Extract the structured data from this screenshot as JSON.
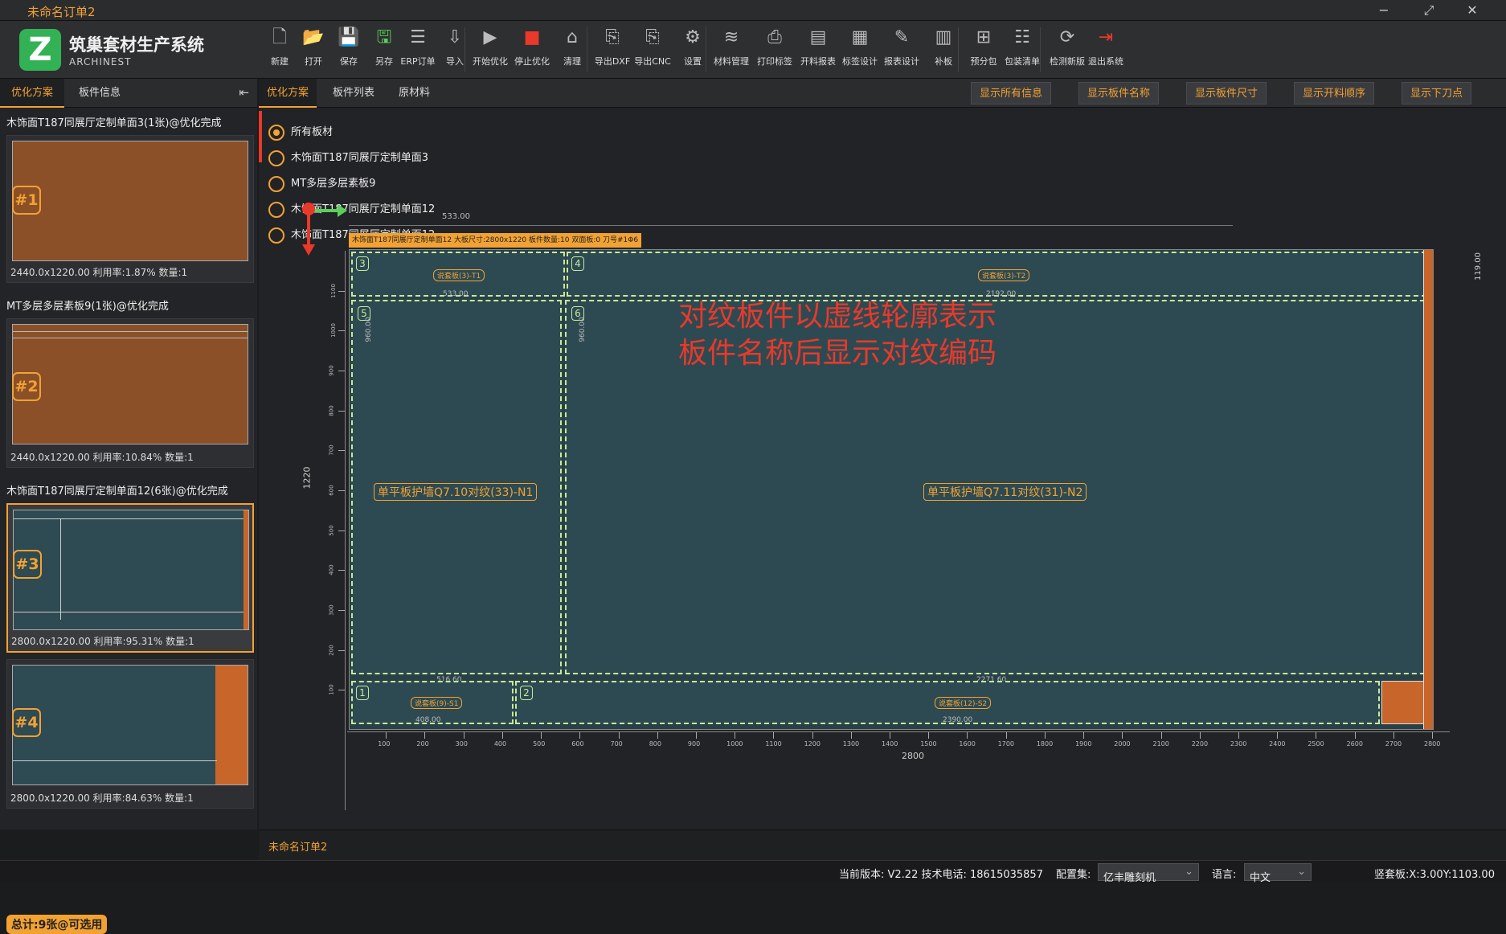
{
  "window": {
    "title": "未命名订单2",
    "min": "−",
    "max": "⤢",
    "close": "✕"
  },
  "brand": {
    "logo": "Z",
    "name": "筑巢套材生产系统",
    "sub": "ARCHINEST"
  },
  "toolbar": [
    {
      "label": "新建",
      "icon": "new-file-icon",
      "glyph": "🗋"
    },
    {
      "label": "打开",
      "icon": "open-folder-icon",
      "glyph": "📂"
    },
    {
      "label": "保存",
      "icon": "save-icon",
      "glyph": "💾"
    },
    {
      "label": "另存",
      "icon": "save-as-icon",
      "glyph": "🖫"
    },
    {
      "label": "ERP订单",
      "icon": "erp-order-icon",
      "glyph": "☰"
    },
    {
      "label": "导入",
      "icon": "import-xml-icon",
      "glyph": "⇩"
    },
    {
      "label": "开始优化",
      "icon": "start-optimize-icon",
      "glyph": "▶"
    },
    {
      "label": "停止优化",
      "icon": "stop-optimize-icon",
      "glyph": "■"
    },
    {
      "label": "清理",
      "icon": "clean-broom-icon",
      "glyph": "⌂"
    },
    {
      "label": "导出DXF",
      "icon": "export-dxf-icon",
      "glyph": "⎘"
    },
    {
      "label": "导出CNC",
      "icon": "export-cnc-icon",
      "glyph": "⎘"
    },
    {
      "label": "设置",
      "icon": "settings-gear-icon",
      "glyph": "⚙"
    },
    {
      "label": "材料管理",
      "icon": "material-layers-icon",
      "glyph": "≋"
    },
    {
      "label": "打印标签",
      "icon": "print-label-icon",
      "glyph": "⎙"
    },
    {
      "label": "开料报表",
      "icon": "cut-report-icon",
      "glyph": "▤"
    },
    {
      "label": "标签设计",
      "icon": "label-design-icon",
      "glyph": "▦"
    },
    {
      "label": "报表设计",
      "icon": "report-design-icon",
      "glyph": "✎"
    },
    {
      "label": "补板",
      "icon": "patch-board-icon",
      "glyph": "▥"
    },
    {
      "label": "预分包",
      "icon": "pre-package-icon",
      "glyph": "⊞"
    },
    {
      "label": "包装清单",
      "icon": "package-list-icon",
      "glyph": "☷"
    },
    {
      "label": "检测新版",
      "icon": "check-update-icon",
      "glyph": "⟳"
    },
    {
      "label": "退出系统",
      "icon": "exit-icon",
      "glyph": "⇥"
    }
  ],
  "left_tabs": [
    "优化方案",
    "板件信息"
  ],
  "left_collapse": "⇤",
  "groups": [
    {
      "title": "木饰面T187同展厅定制单面3(1张)@优化完成"
    },
    {
      "title": "MT多层多层素板9(1张)@优化完成"
    },
    {
      "title": "木饰面T187同展厅定制单面12(6张)@优化完成"
    }
  ],
  "cards": [
    {
      "badge": "#1",
      "info": "2440.0x1220.00 利用率:1.87% 数量:1"
    },
    {
      "badge": "#2",
      "info": "2440.0x1220.00 利用率:10.84% 数量:1"
    },
    {
      "badge": "#3",
      "info": "2800.0x1220.00 利用率:95.31% 数量:1"
    },
    {
      "badge": "#4",
      "info": "2800.0x1220.00 利用率:84.63% 数量:1"
    }
  ],
  "total": "总计:9张@可选用",
  "main_tabs": [
    "优化方案",
    "板件列表",
    "原材料"
  ],
  "show_buttons": [
    "显示所有信息",
    "显示板件名称",
    "显示板件尺寸",
    "显示开料顺序",
    "显示下刀点"
  ],
  "filters": [
    {
      "label": "所有板材",
      "checked": true
    },
    {
      "label": "木饰面T187同展厅定制单面3",
      "checked": false
    },
    {
      "label": "MT多层多层素板9",
      "checked": false
    },
    {
      "label": "木饰面T187同展厅定制单面12",
      "checked": false
    },
    {
      "label": "木饰面T187同展厅定制单面12",
      "checked": false
    }
  ],
  "sheet": {
    "header": "木饰面T187同展厅定制单面12 大板尺寸:2800x1220 板件数量:10 双面板:0 刀号#1Φ6",
    "top_dim": "533.00",
    "width_label": "2800",
    "height_label": "1220",
    "right_dim": "119.00",
    "parts": [
      {
        "num": "5",
        "label": "单平板护墙Q7.10对纹(33)-N1",
        "dim": "960.00"
      },
      {
        "num": "6",
        "label": "单平板护墙Q7.11对纹(31)-N2",
        "dim": "960.00"
      },
      {
        "num": "3",
        "label": "说套板(3)-T1",
        "dim": "533.00"
      },
      {
        "num": "4",
        "label": "说套板(3)-T2",
        "dim": "2192.00"
      },
      {
        "num": "1",
        "label": "说套板(9)-S1",
        "dim": "408.00"
      },
      {
        "num": "2",
        "label": "说套板(12)-S2",
        "dim": "2390.00"
      }
    ],
    "mid_dims": [
      "516.60",
      "2271.60"
    ],
    "xticks": [
      "100",
      "200",
      "300",
      "400",
      "500",
      "600",
      "700",
      "800",
      "900",
      "1000",
      "1100",
      "1200",
      "1300",
      "1400",
      "1500",
      "1600",
      "1700",
      "1800",
      "1900",
      "2000",
      "2100",
      "2200",
      "2300",
      "2400",
      "2500",
      "2600",
      "2700",
      "2800"
    ],
    "yticks": [
      "1100",
      "1000",
      "900",
      "800",
      "700",
      "600",
      "500",
      "400",
      "300",
      "200",
      "100"
    ]
  },
  "note": {
    "line1": "对纹板件以虚线轮廓表示",
    "line2": "板件名称后显示对纹编码"
  },
  "footer_file": "未命名订单2",
  "status": {
    "version": "当前版本: V2.22 技术电话: 18615035857",
    "config_label": "配置集:",
    "config_value": "亿丰雕刻机",
    "lang_label": "语言:",
    "lang_value": "中文",
    "coords": "竖套板:X:3.00Y:1103.00"
  },
  "colors": {
    "accent": "#f2a233",
    "sheet": "#2d4a52",
    "dash": "#c8e89b",
    "note": "#e9392a",
    "waste": "#c8652a"
  }
}
